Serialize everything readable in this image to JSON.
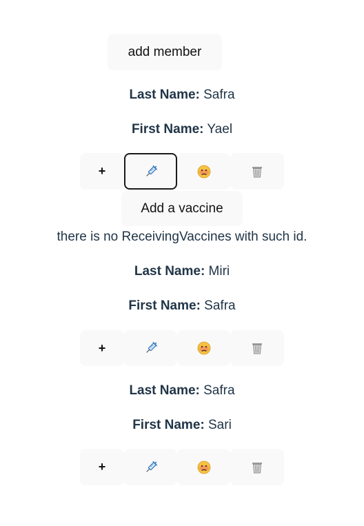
{
  "header": {
    "add_member_label": "add member"
  },
  "labels": {
    "last_name": "Last Name:",
    "first_name": "First Name:"
  },
  "members": [
    {
      "last_name": " Safra",
      "first_name": " Yael"
    },
    {
      "last_name": " Miri",
      "first_name": " Safra"
    },
    {
      "last_name": " Safra",
      "first_name": " Sari"
    }
  ],
  "actions": {
    "plus_label": "+",
    "icons": [
      "syringe-icon",
      "sick-face-icon",
      "trash-can-icon"
    ]
  },
  "vaccine_panel": {
    "add_vaccine_label": "Add a vaccine",
    "message": "there is no ReceivingVaccines with such id."
  }
}
